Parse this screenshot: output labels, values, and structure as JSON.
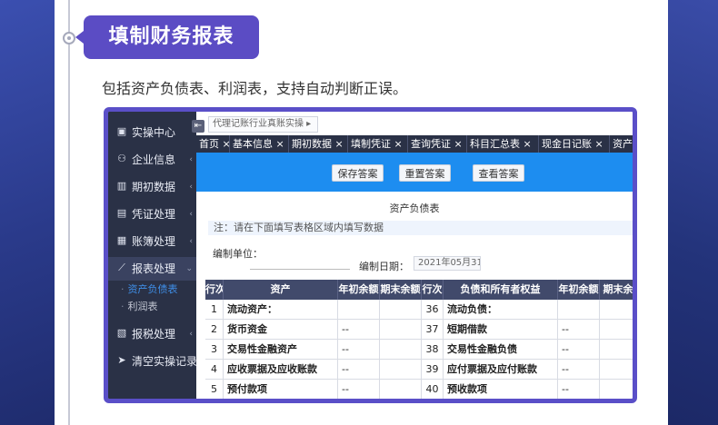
{
  "heading": {
    "title": "填制财务报表",
    "subtitle": "包括资产负债表、利润表，支持自动判断正误。"
  },
  "sidebar": {
    "items": [
      {
        "label": "实操中心",
        "icon": "clipboard-icon",
        "glyph": "▣"
      },
      {
        "label": "企业信息",
        "icon": "users-icon",
        "glyph": "⚇"
      },
      {
        "label": "期初数据",
        "icon": "bar-chart-icon",
        "glyph": "▥"
      },
      {
        "label": "凭证处理",
        "icon": "document-icon",
        "glyph": "▤"
      },
      {
        "label": "账簿处理",
        "icon": "book-icon",
        "glyph": "▦"
      },
      {
        "label": "报表处理",
        "icon": "line-chart-icon",
        "glyph": "⟋"
      },
      {
        "label": "报税处理",
        "icon": "tax-icon",
        "glyph": "▧"
      },
      {
        "label": "清空实操记录",
        "icon": "send-icon",
        "glyph": "➤"
      }
    ],
    "sub_items": [
      "资产负债表",
      "利润表"
    ]
  },
  "breadcrumb": "代理记账行业真账实操 ▸",
  "tabs": [
    "首页 ×",
    "基本信息 ×",
    "期初数据 ×",
    "填制凭证 ×",
    "查询凭证 ×",
    "科目汇总表 ×",
    "现金日记账 ×",
    "资产"
  ],
  "toolbar": {
    "save": "保存答案",
    "reset": "重置答案",
    "view": "查看答案"
  },
  "sheet": {
    "title": "资产负债表",
    "note": "注：请在下面填写表格区域内填写数据",
    "unit_label": "编制单位：",
    "date_label": "编制日期：",
    "date_value": "2021年05月31"
  },
  "table": {
    "headers": [
      "行次",
      "资产",
      "年初余额",
      "期末余额",
      "行次",
      "负债和所有者权益",
      "年初余额",
      "期末余"
    ],
    "rows": [
      {
        "no1": "1",
        "asset": "流动资产：",
        "b1": "",
        "e1": "",
        "no2": "36",
        "liab": "流动负债：",
        "b2": "",
        "e2": ""
      },
      {
        "no1": "2",
        "asset": "货币资金",
        "b1": "--",
        "e1": "",
        "no2": "37",
        "liab": "短期借款",
        "b2": "--",
        "e2": ""
      },
      {
        "no1": "3",
        "asset": "交易性金融资产",
        "b1": "--",
        "e1": "",
        "no2": "38",
        "liab": "交易性金融负债",
        "b2": "--",
        "e2": ""
      },
      {
        "no1": "4",
        "asset": "应收票据及应收账款",
        "b1": "--",
        "e1": "",
        "no2": "39",
        "liab": "应付票据及应付账款",
        "b2": "--",
        "e2": ""
      },
      {
        "no1": "5",
        "asset": "预付款项",
        "b1": "--",
        "e1": "",
        "no2": "40",
        "liab": "预收款项",
        "b2": "--",
        "e2": ""
      }
    ]
  },
  "colors": {
    "accent": "#5b4cc4",
    "toolbar_blue": "#1d8df0",
    "sidebar_dark": "#2a3146",
    "table_header": "#414a6b"
  }
}
